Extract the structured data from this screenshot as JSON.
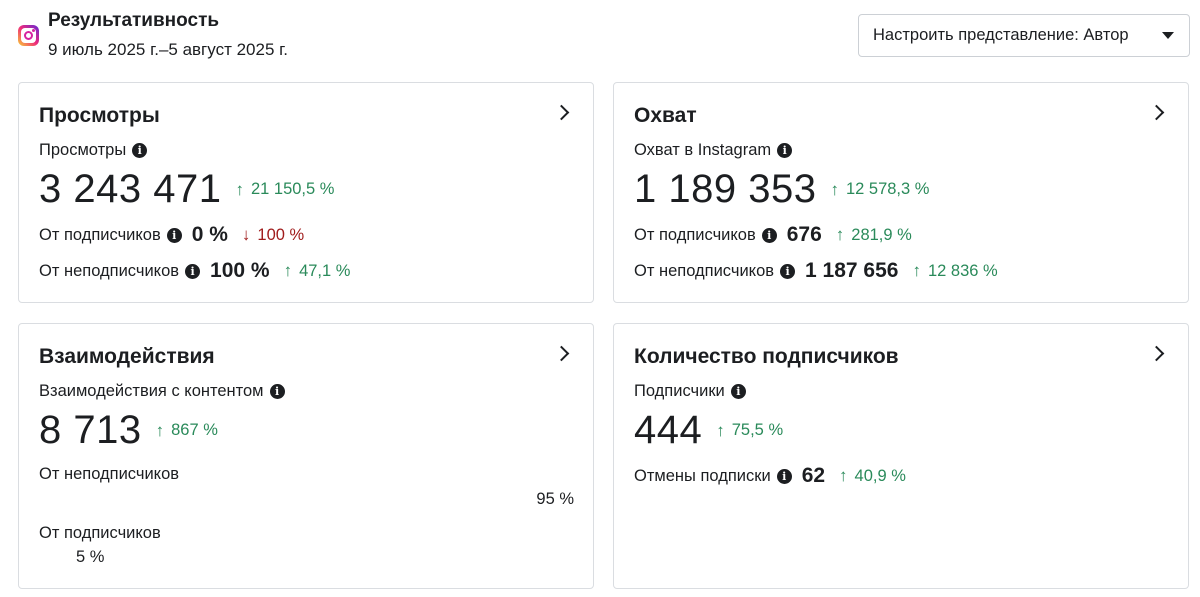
{
  "header": {
    "title": "Результативность",
    "date_range": "9 июль 2025 г.–5 август 2025 г.",
    "view_button_label": "Настроить представление: Автор",
    "icon": "instagram-icon"
  },
  "cards": {
    "views": {
      "title": "Просмотры",
      "metric_label": "Просмотры",
      "metric_value": "3 243 471",
      "metric_delta": "21 150,5 %",
      "from_followers_label": "От подписчиков",
      "from_followers_value": "0 %",
      "from_followers_delta": "100 %",
      "from_nonfollowers_label": "От неподписчиков",
      "from_nonfollowers_value": "100 %",
      "from_nonfollowers_delta": "47,1 %"
    },
    "reach": {
      "title": "Охват",
      "metric_label": "Охват в Instagram",
      "metric_value": "1 189 353",
      "metric_delta": "12 578,3 %",
      "from_followers_label": "От подписчиков",
      "from_followers_value": "676",
      "from_followers_delta": "281,9 %",
      "from_nonfollowers_label": "От неподписчиков",
      "from_nonfollowers_value": "1 187 656",
      "from_nonfollowers_delta": "12 836 %"
    },
    "interactions": {
      "title": "Взаимодействия",
      "metric_label": "Взаимодействия с контентом",
      "metric_value": "8 713",
      "metric_delta": "867 %",
      "nonfollowers_label": "От неподписчиков",
      "nonfollowers_pct": "95 %",
      "followers_label": "От подписчиков",
      "followers_pct": "5 %"
    },
    "followers": {
      "title": "Количество подписчиков",
      "metric_label": "Подписчики",
      "metric_value": "444",
      "metric_delta": "75,5 %",
      "unfollows_label": "Отмены подписки",
      "unfollows_value": "62",
      "unfollows_delta": "40,9 %"
    }
  },
  "colors": {
    "positive": "#2a8a5a",
    "negative": "#a01c1c"
  }
}
